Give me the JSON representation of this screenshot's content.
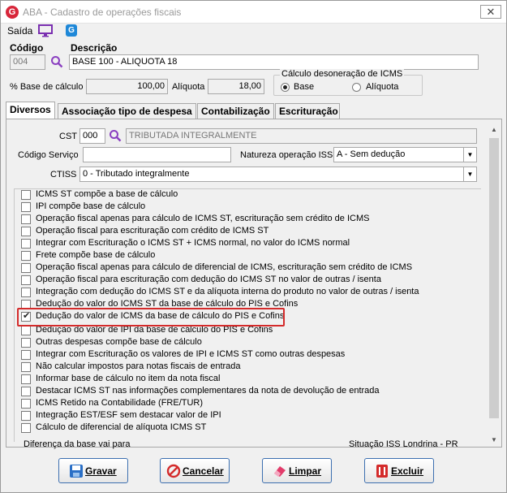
{
  "window": {
    "title": "ABA - Cadastro de operações fiscais",
    "app_logo": "G"
  },
  "menu": {
    "saida": "Saída",
    "app_icon": "G"
  },
  "header": {
    "codigo_label": "Código",
    "codigo_value": "004",
    "descricao_label": "Descrição",
    "descricao_value": "BASE 100 - ALIQUOTA 18",
    "base_calculo_label": "% Base de cálculo",
    "base_calculo_value": "100,00",
    "aliquota_label": "Alíquota",
    "aliquota_value": "18,00",
    "desoneracao_title": "Cálculo desoneração de ICMS",
    "radio_base": "Base",
    "radio_aliquota": "Alíquota",
    "selected": "Base"
  },
  "tabs": [
    "Diversos",
    "Associação tipo de despesa",
    "Contabilização",
    "Escrituração"
  ],
  "diversos": {
    "cst_label": "CST",
    "cst_code": "000",
    "cst_desc": "TRIBUTADA INTEGRALMENTE",
    "codigo_servico_label": "Código Serviço",
    "codigo_servico_value": "",
    "natureza_label": "Natureza operação ISS",
    "natureza_value": "A - Sem dedução",
    "ctiss_label": "CTISS",
    "ctiss_value": "0 - Tributado integralmente",
    "checkboxes": [
      {
        "label": "ICMS ST compõe a base de cálculo",
        "checked": false
      },
      {
        "label": "IPI compõe base de cálculo",
        "checked": false
      },
      {
        "label": "Operação fiscal apenas para cálculo de ICMS ST, escrituração sem crédito de ICMS",
        "checked": false
      },
      {
        "label": "Operação fiscal para escrituração com crédito de ICMS ST",
        "checked": false
      },
      {
        "label": "Integrar com Escrituração o ICMS ST + ICMS normal,  no valor do ICMS normal",
        "checked": false
      },
      {
        "label": "Frete compõe base de cálculo",
        "checked": false
      },
      {
        "label": "Operação fiscal apenas para cálculo de diferencial de ICMS, escrituração sem crédito de ICMS",
        "checked": false
      },
      {
        "label": "Operação fiscal para escrituração com dedução do ICMS ST no valor de outras / isenta",
        "checked": false
      },
      {
        "label": "Integração com dedução do ICMS ST e da alíquota interna do produto no valor de outras / isenta",
        "checked": false
      },
      {
        "label": "Dedução do valor do ICMS ST da base de cálculo do PIS e Cofins",
        "checked": false
      },
      {
        "label": "Dedução do valor de ICMS da base de cálculo do PIS e Cofins",
        "checked": true
      },
      {
        "label": "Dedução do valor de IPI da base de cálculo do PIS e Cofins",
        "checked": false
      },
      {
        "label": "Outras despesas compõe base de cálculo",
        "checked": false
      },
      {
        "label": "Integrar com Escrituração os valores de IPI e ICMS ST como outras despesas",
        "checked": false
      },
      {
        "label": "Não calcular impostos para notas fiscais de entrada",
        "checked": false
      },
      {
        "label": "Informar base de cálculo no item da nota fiscal",
        "checked": false
      },
      {
        "label": "Destacar ICMS ST nas informações complementares da nota de devolução de entrada",
        "checked": false
      },
      {
        "label": "ICMS Retido na Contabilidade (FRE/TUR)",
        "checked": false
      },
      {
        "label": "Integração EST/ESF sem destacar valor de IPI",
        "checked": false
      },
      {
        "label": "Cálculo de diferencial de alíquota ICMS ST",
        "checked": false
      }
    ],
    "group_diferenca": "Diferença da base vai para",
    "group_situacao": "Situação ISS Londrina - PR"
  },
  "buttons": {
    "gravar": "Gravar",
    "cancelar": "Cancelar",
    "limpar": "Limpar",
    "excluir": "Excluir"
  },
  "colors": {
    "accent": "#7a2fb0",
    "highlight": "#d42b2b",
    "button_border": "#3c6fb0"
  }
}
